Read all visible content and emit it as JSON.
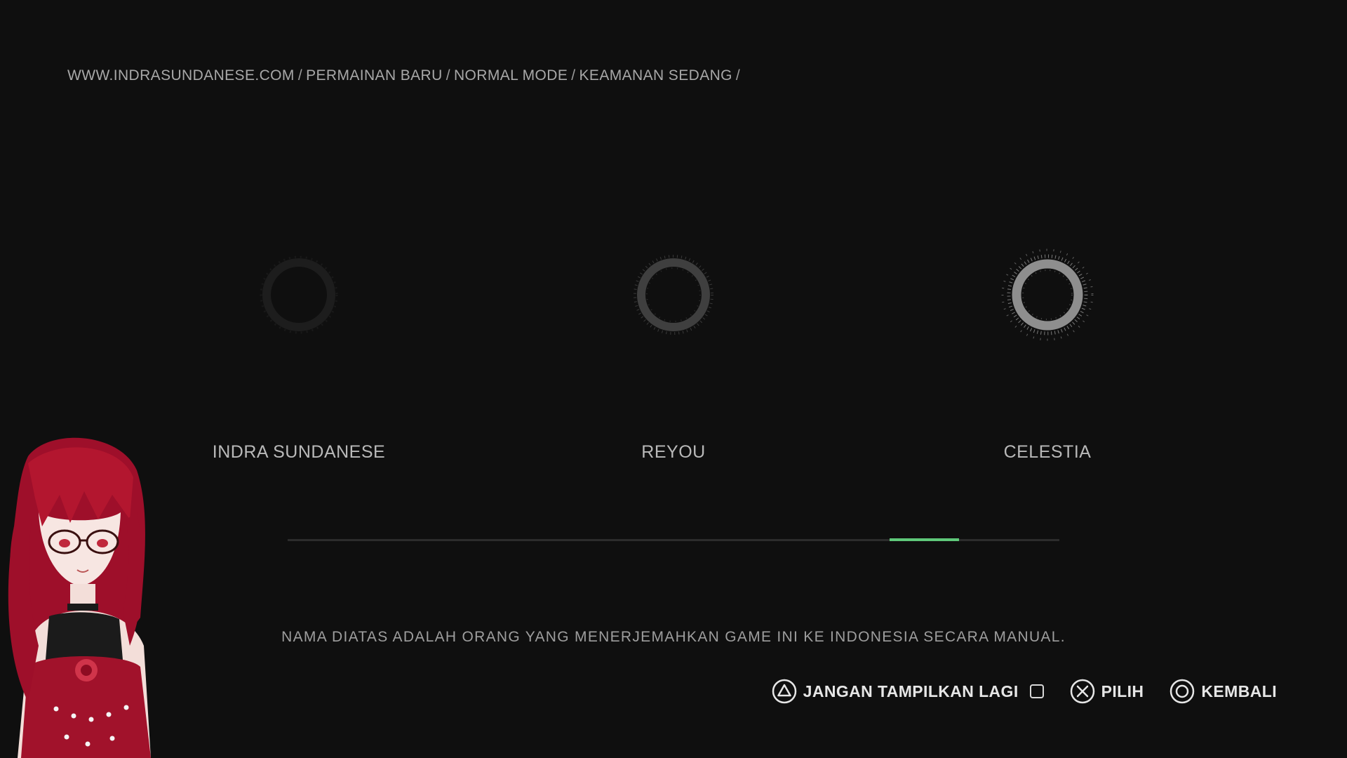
{
  "breadcrumb": {
    "items": [
      "WWW.INDRASUNDANESE.COM",
      "PERMAINAN BARU",
      "NORMAL MODE",
      "KEAMANAN SEDANG"
    ],
    "separator": "/"
  },
  "credits": [
    {
      "name": "INDRA SUNDANESE",
      "icon": "grunge-ring-icon"
    },
    {
      "name": "REYOU",
      "icon": "grunge-ring-icon"
    },
    {
      "name": "CELESTIA",
      "icon": "grunge-ring-icon"
    }
  ],
  "progress": {
    "fill_start_fraction": 0.78,
    "fill_end_fraction": 0.87,
    "color": "#5fc87a"
  },
  "note": "NAMA DIATAS ADALAH ORANG YANG MENERJEMAHKAN GAME INI KE INDONESIA SECARA MANUAL.",
  "controls": {
    "dont_show": {
      "label": "JANGAN TAMPILKAN LAGI",
      "icon": "triangle-button-icon",
      "checked": false
    },
    "select": {
      "label": "PILIH",
      "icon": "cross-button-icon"
    },
    "back": {
      "label": "KEMBALI",
      "icon": "circle-button-icon"
    }
  },
  "colors": {
    "background": "#0f0f0f",
    "text": "#c9c9c9",
    "accent": "#5fc87a"
  },
  "overlay": {
    "avatar": "vtuber-avatar-red-hair"
  }
}
